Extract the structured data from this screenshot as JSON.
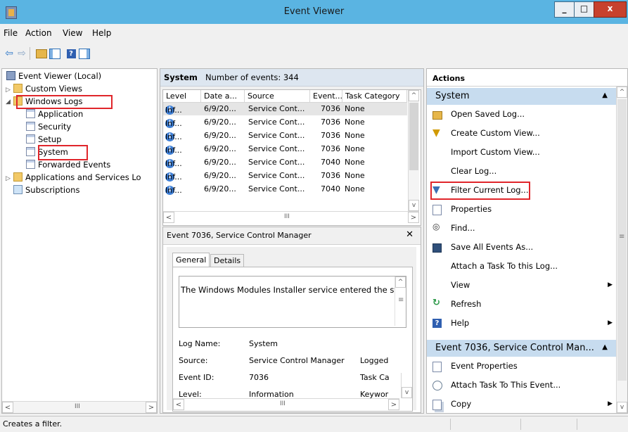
{
  "window": {
    "title": "Event Viewer",
    "min_label": "_",
    "max_label": "□",
    "close_label": "x"
  },
  "menu": {
    "file": "File",
    "action": "Action",
    "view": "View",
    "help": "Help"
  },
  "tree": {
    "root": "Event Viewer (Local)",
    "custom_views": "Custom Views",
    "windows_logs": "Windows Logs",
    "application": "Application",
    "security": "Security",
    "setup": "Setup",
    "system": "System",
    "forwarded": "Forwarded Events",
    "apps_services": "Applications and Services Lo",
    "subscriptions": "Subscriptions"
  },
  "log": {
    "name": "System",
    "count_text": "Number of events: 344",
    "columns": [
      "Level",
      "Date a...",
      "Source",
      "Event...",
      "Task Category"
    ],
    "rows": [
      {
        "level": "Inf...",
        "date": "6/9/20...",
        "source": "Service Cont...",
        "event": "7036",
        "task": "None"
      },
      {
        "level": "Inf...",
        "date": "6/9/20...",
        "source": "Service Cont...",
        "event": "7036",
        "task": "None"
      },
      {
        "level": "Inf...",
        "date": "6/9/20...",
        "source": "Service Cont...",
        "event": "7036",
        "task": "None"
      },
      {
        "level": "Inf...",
        "date": "6/9/20...",
        "source": "Service Cont...",
        "event": "7036",
        "task": "None"
      },
      {
        "level": "Inf...",
        "date": "6/9/20...",
        "source": "Service Cont...",
        "event": "7040",
        "task": "None"
      },
      {
        "level": "Inf...",
        "date": "6/9/20...",
        "source": "Service Cont...",
        "event": "7036",
        "task": "None"
      },
      {
        "level": "Inf...",
        "date": "6/9/20...",
        "source": "Service Cont...",
        "event": "7040",
        "task": "None"
      }
    ]
  },
  "event_detail": {
    "header": "Event 7036, Service Control Manager",
    "tab_general": "General",
    "tab_details": "Details",
    "message": "The Windows Modules Installer service entered the stopp",
    "log_name_label": "Log Name:",
    "log_name_value": "System",
    "source_label": "Source:",
    "source_value": "Service Control Manager",
    "logged_label": "Logged",
    "event_id_label": "Event ID:",
    "event_id_value": "7036",
    "task_label": "Task Ca",
    "level_label": "Level:",
    "level_value": "Information",
    "keywords_label": "Keywor"
  },
  "actions": {
    "title": "Actions",
    "system_section": "System",
    "items": [
      "Open Saved Log...",
      "Create Custom View...",
      "Import Custom View...",
      "Clear Log...",
      "Filter Current Log...",
      "Properties",
      "Find...",
      "Save All Events As...",
      "Attach a Task To this Log...",
      "View",
      "Refresh",
      "Help"
    ],
    "event_section": "Event 7036, Service Control Man...",
    "event_items": [
      "Event Properties",
      "Attach Task To This Event...",
      "Copy"
    ]
  },
  "status_text": "Creates a filter.",
  "colors": {
    "title_bar": "#5ab4e2",
    "highlight": "#e0262b",
    "close": "#c7412e",
    "section": "#c7dcef"
  }
}
